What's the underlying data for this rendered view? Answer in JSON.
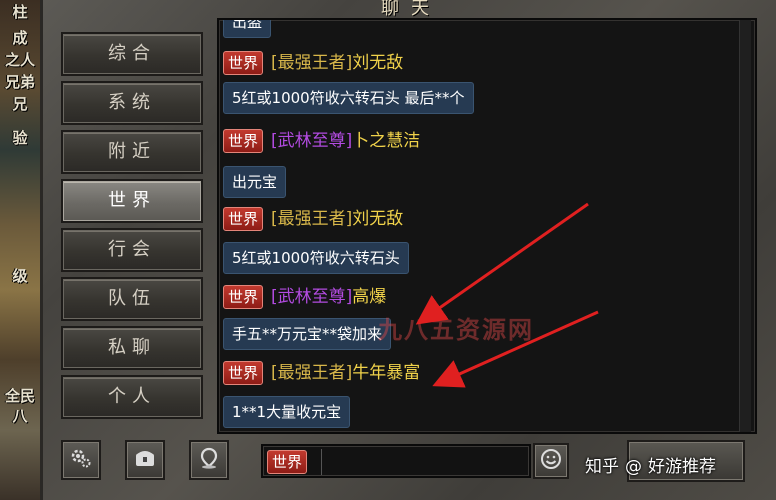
{
  "window": {
    "title": "聊天"
  },
  "left_fragments": [
    "柱",
    "成",
    "之人",
    "兄弟",
    "兄",
    "验",
    "级",
    "全民",
    "八"
  ],
  "tabs": [
    {
      "label": "综合",
      "active": false
    },
    {
      "label": "系统",
      "active": false
    },
    {
      "label": "附近",
      "active": false
    },
    {
      "label": "世界",
      "active": true
    },
    {
      "label": "行会",
      "active": false
    },
    {
      "label": "队伍",
      "active": false
    },
    {
      "label": "私聊",
      "active": false
    },
    {
      "label": "个人",
      "active": false
    }
  ],
  "chat": {
    "partial_top": "出盗",
    "messages": [
      {
        "channel": "世界",
        "title": "[最强王者]",
        "title_color": "gold",
        "name": "刘无敌",
        "text": "5红或1000符收六转石头 最后**个"
      },
      {
        "channel": "世界",
        "title": "[武林至尊]",
        "title_color": "purple",
        "name": "卜之慧洁",
        "text": "出元宝"
      },
      {
        "channel": "世界",
        "title": "[最强王者]",
        "title_color": "gold",
        "name": "刘无敌",
        "text": "5红或1000符收六转石头"
      },
      {
        "channel": "世界",
        "title": "[武林至尊]",
        "title_color": "purple",
        "name": "高爆",
        "text": "手五**万元宝**袋加来"
      },
      {
        "channel": "世界",
        "title": "[最强王者]",
        "title_color": "gold",
        "name": "牛年暴富",
        "text": "1**1大量收元宝"
      }
    ]
  },
  "watermark": "九八五资源网",
  "bottom": {
    "channel_badge": "世界",
    "input_value": "",
    "icons": [
      "gear-icon",
      "chest-icon",
      "location-pin-icon",
      "smiley-icon"
    ]
  },
  "overlay": {
    "site": "知乎",
    "separator": "@",
    "author": "好游推荐"
  },
  "colors": {
    "badge_red": "#b32c22",
    "title_gold": "#d8b74a",
    "title_purple": "#b24be0",
    "name_yellow": "#f0d24a",
    "bubble_blue": "#263a52",
    "arrow_red": "#e02020"
  }
}
